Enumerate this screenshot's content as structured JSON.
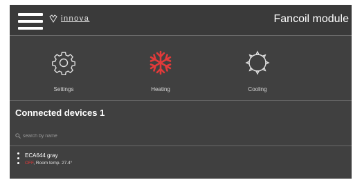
{
  "header": {
    "brand": "innova",
    "title": "Fancoil module"
  },
  "modes": [
    {
      "label": "Settings",
      "icon": "gear-icon",
      "color": "#e0e0e0"
    },
    {
      "label": "Heating",
      "icon": "snowflake-icon",
      "color": "#e23a3a"
    },
    {
      "label": "Cooling",
      "icon": "sun-icon",
      "color": "#e0e0e0"
    }
  ],
  "devices_section": {
    "title": "Connected devices 1",
    "search_placeholder": "search by name"
  },
  "devices": [
    {
      "name": "ECA644 gray",
      "state": "OFF",
      "room_temp": "Room temp. 27.4°"
    }
  ],
  "colors": {
    "background": "#404040",
    "accent": "#e23a3a"
  }
}
